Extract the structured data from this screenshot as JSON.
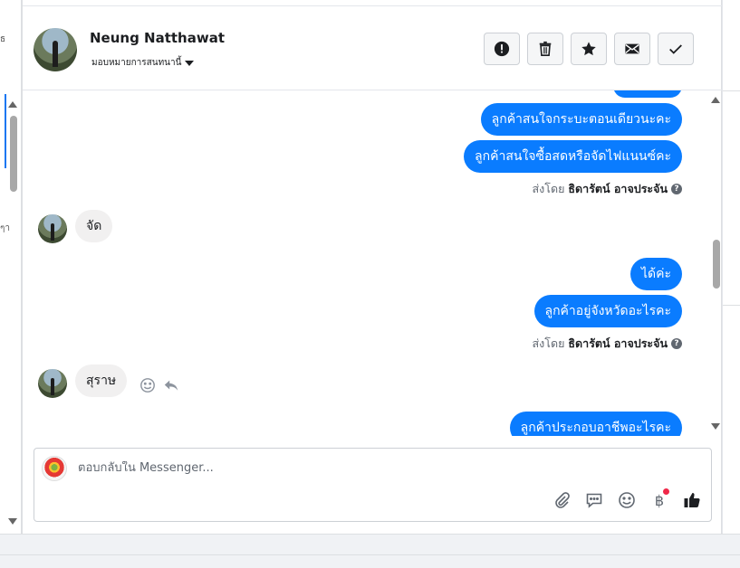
{
  "header": {
    "customer_name": "Neung Natthawat",
    "assign_label": "มอบหมายการสนทนานี้"
  },
  "left_fragments": [
    "ธ",
    "ๆา"
  ],
  "actions": [
    {
      "name": "report-button",
      "icon": "exclamation-icon"
    },
    {
      "name": "delete-button",
      "icon": "trash-icon"
    },
    {
      "name": "star-button",
      "icon": "star-icon"
    },
    {
      "name": "mark-unread-button",
      "icon": "envelope-icon"
    },
    {
      "name": "mark-done-button",
      "icon": "check-icon"
    }
  ],
  "messages": {
    "out_1": "ลูกค้าสนใจกระบะตอนเดียวนะคะ",
    "out_2": "ลูกค้าสนใจซื้อสดหรือจัดไฟแนนซ์คะ",
    "sent_by_1": {
      "prefix": "ส่งโดย",
      "agent": "ธิดารัตน์ อาจประจัน"
    },
    "in_1": "จัด",
    "out_3": "ได้ค่ะ",
    "out_4": "ลูกค้าอยู่จังหวัดอะไรคะ",
    "sent_by_2": {
      "prefix": "ส่งโดย",
      "agent": "ธิดารัตน์ อาจประจัน"
    },
    "in_2": "สุราษ",
    "out_5": "ลูกค้าประกอบอาชีพอะไรคะ"
  },
  "composer": {
    "placeholder": "ตอบกลับใน Messenger...",
    "baht_symbol": "฿",
    "tools": [
      "paperclip-icon",
      "saved-reply-icon",
      "emoji-icon",
      "baht-icon",
      "like-icon"
    ]
  },
  "colors": {
    "outgoing_bubble": "#0a7cff",
    "incoming_bubble": "#f1f0f0",
    "notification_dot": "#f02849"
  }
}
